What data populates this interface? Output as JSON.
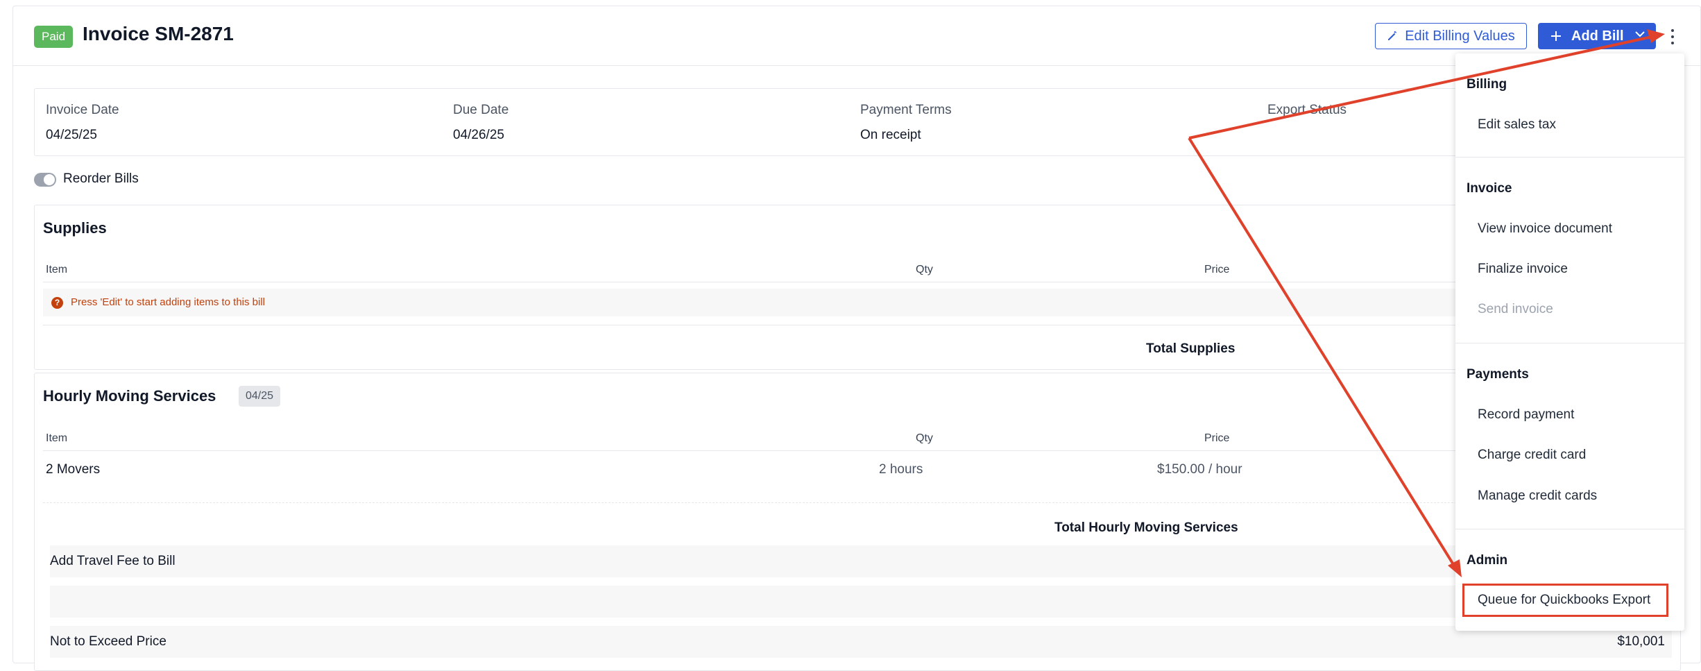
{
  "header": {
    "badge": "Paid",
    "title": "Invoice SM-2871",
    "edit_billing": "Edit Billing Values",
    "add_bill": "Add Bill"
  },
  "meta": {
    "invoice_date_label": "Invoice Date",
    "invoice_date": "04/25/25",
    "due_date_label": "Due Date",
    "due_date": "04/26/25",
    "payment_terms_label": "Payment Terms",
    "payment_terms": "On receipt",
    "export_status_label": "Export Status"
  },
  "reorder_label": "Reorder Bills",
  "supplies": {
    "title": "Supplies",
    "col_item": "Item",
    "col_qty": "Qty",
    "col_price": "Price",
    "empty_msg": "Press 'Edit' to start adding items to this bill",
    "total_label": "Total Supplies"
  },
  "hourly": {
    "title": "Hourly Moving Services",
    "date_chip": "04/25",
    "col_item": "Item",
    "col_qty": "Qty",
    "col_price": "Price",
    "row_item": "2 Movers",
    "row_qty": "2 hours",
    "row_price": "$150.00 / hour",
    "total_label": "Total Hourly Moving Services",
    "travel_fee": "Add Travel Fee to Bill",
    "nte_label": "Not to Exceed Price",
    "nte_value": "$10,001"
  },
  "menu": {
    "billing": "Billing",
    "edit_sales_tax": "Edit sales tax",
    "invoice": "Invoice",
    "view_invoice_document": "View invoice document",
    "finalize_invoice": "Finalize invoice",
    "send_invoice": "Send invoice",
    "payments": "Payments",
    "record_payment": "Record payment",
    "charge_credit_card": "Charge credit card",
    "manage_credit_cards": "Manage credit cards",
    "admin": "Admin",
    "queue_quickbooks": "Queue for Quickbooks Export"
  },
  "colors": {
    "accent": "#2f5cd6",
    "paid": "#5cb85c",
    "annotation": "#e0412b"
  }
}
